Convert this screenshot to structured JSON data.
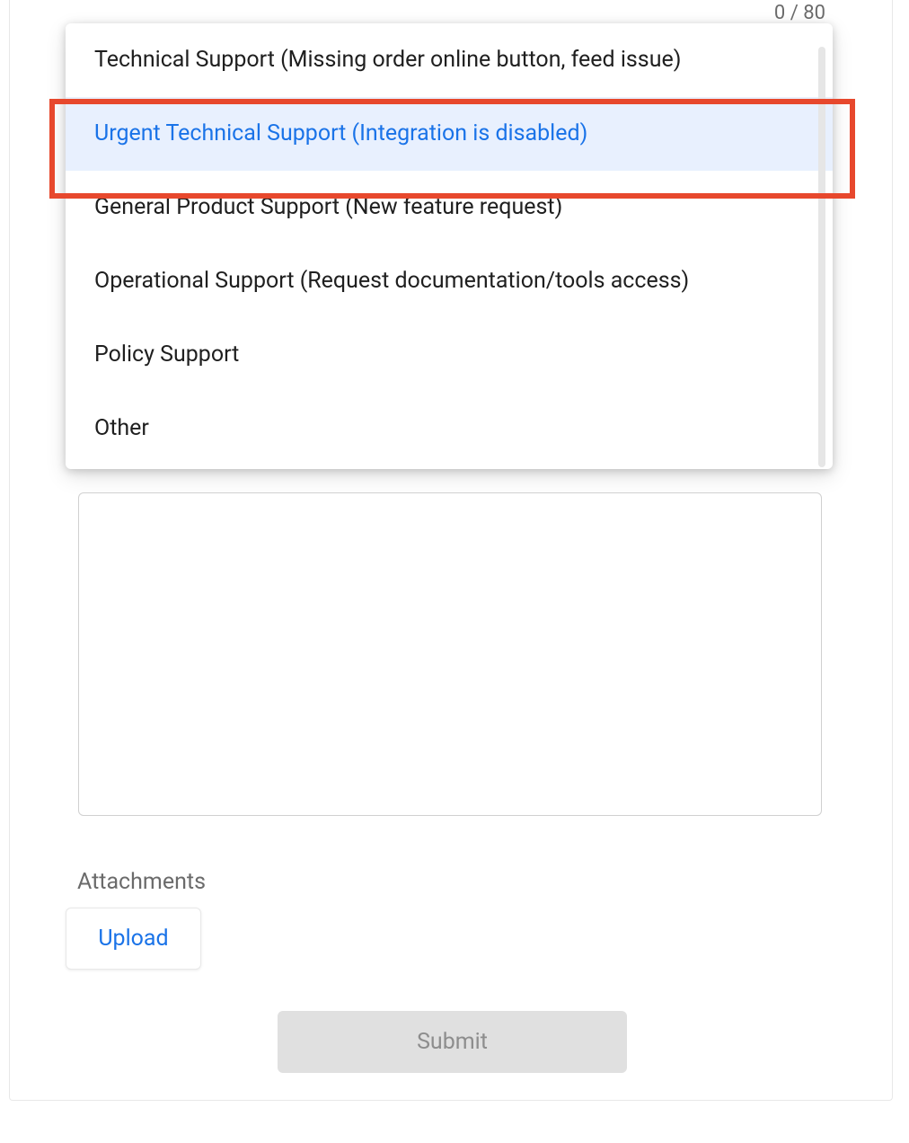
{
  "char_counter": "0 / 80",
  "dropdown": {
    "options": [
      "Technical Support (Missing order online button, feed issue)",
      "Urgent Technical Support (Integration is disabled)",
      "General Product Support (New feature request)",
      "Operational Support (Request documentation/tools access)",
      "Policy Support",
      "Other"
    ],
    "selected_index": 1
  },
  "attachments_label": "Attachments",
  "upload_label": "Upload",
  "submit_label": "Submit"
}
